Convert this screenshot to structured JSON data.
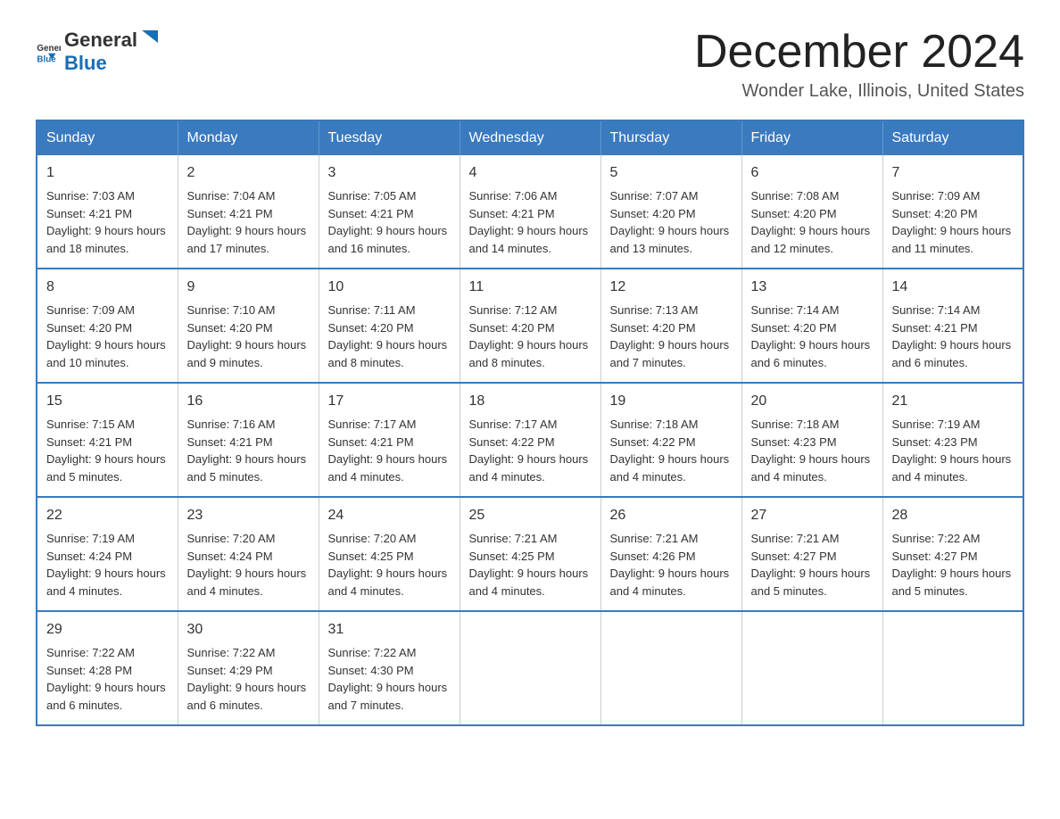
{
  "logo": {
    "text_general": "General",
    "text_blue": "Blue"
  },
  "title": "December 2024",
  "location": "Wonder Lake, Illinois, United States",
  "weekdays": [
    "Sunday",
    "Monday",
    "Tuesday",
    "Wednesday",
    "Thursday",
    "Friday",
    "Saturday"
  ],
  "weeks": [
    [
      {
        "day": "1",
        "sunrise": "7:03 AM",
        "sunset": "4:21 PM",
        "daylight": "9 hours and 18 minutes."
      },
      {
        "day": "2",
        "sunrise": "7:04 AM",
        "sunset": "4:21 PM",
        "daylight": "9 hours and 17 minutes."
      },
      {
        "day": "3",
        "sunrise": "7:05 AM",
        "sunset": "4:21 PM",
        "daylight": "9 hours and 16 minutes."
      },
      {
        "day": "4",
        "sunrise": "7:06 AM",
        "sunset": "4:21 PM",
        "daylight": "9 hours and 14 minutes."
      },
      {
        "day": "5",
        "sunrise": "7:07 AM",
        "sunset": "4:20 PM",
        "daylight": "9 hours and 13 minutes."
      },
      {
        "day": "6",
        "sunrise": "7:08 AM",
        "sunset": "4:20 PM",
        "daylight": "9 hours and 12 minutes."
      },
      {
        "day": "7",
        "sunrise": "7:09 AM",
        "sunset": "4:20 PM",
        "daylight": "9 hours and 11 minutes."
      }
    ],
    [
      {
        "day": "8",
        "sunrise": "7:09 AM",
        "sunset": "4:20 PM",
        "daylight": "9 hours and 10 minutes."
      },
      {
        "day": "9",
        "sunrise": "7:10 AM",
        "sunset": "4:20 PM",
        "daylight": "9 hours and 9 minutes."
      },
      {
        "day": "10",
        "sunrise": "7:11 AM",
        "sunset": "4:20 PM",
        "daylight": "9 hours and 8 minutes."
      },
      {
        "day": "11",
        "sunrise": "7:12 AM",
        "sunset": "4:20 PM",
        "daylight": "9 hours and 8 minutes."
      },
      {
        "day": "12",
        "sunrise": "7:13 AM",
        "sunset": "4:20 PM",
        "daylight": "9 hours and 7 minutes."
      },
      {
        "day": "13",
        "sunrise": "7:14 AM",
        "sunset": "4:20 PM",
        "daylight": "9 hours and 6 minutes."
      },
      {
        "day": "14",
        "sunrise": "7:14 AM",
        "sunset": "4:21 PM",
        "daylight": "9 hours and 6 minutes."
      }
    ],
    [
      {
        "day": "15",
        "sunrise": "7:15 AM",
        "sunset": "4:21 PM",
        "daylight": "9 hours and 5 minutes."
      },
      {
        "day": "16",
        "sunrise": "7:16 AM",
        "sunset": "4:21 PM",
        "daylight": "9 hours and 5 minutes."
      },
      {
        "day": "17",
        "sunrise": "7:17 AM",
        "sunset": "4:21 PM",
        "daylight": "9 hours and 4 minutes."
      },
      {
        "day": "18",
        "sunrise": "7:17 AM",
        "sunset": "4:22 PM",
        "daylight": "9 hours and 4 minutes."
      },
      {
        "day": "19",
        "sunrise": "7:18 AM",
        "sunset": "4:22 PM",
        "daylight": "9 hours and 4 minutes."
      },
      {
        "day": "20",
        "sunrise": "7:18 AM",
        "sunset": "4:23 PM",
        "daylight": "9 hours and 4 minutes."
      },
      {
        "day": "21",
        "sunrise": "7:19 AM",
        "sunset": "4:23 PM",
        "daylight": "9 hours and 4 minutes."
      }
    ],
    [
      {
        "day": "22",
        "sunrise": "7:19 AM",
        "sunset": "4:24 PM",
        "daylight": "9 hours and 4 minutes."
      },
      {
        "day": "23",
        "sunrise": "7:20 AM",
        "sunset": "4:24 PM",
        "daylight": "9 hours and 4 minutes."
      },
      {
        "day": "24",
        "sunrise": "7:20 AM",
        "sunset": "4:25 PM",
        "daylight": "9 hours and 4 minutes."
      },
      {
        "day": "25",
        "sunrise": "7:21 AM",
        "sunset": "4:25 PM",
        "daylight": "9 hours and 4 minutes."
      },
      {
        "day": "26",
        "sunrise": "7:21 AM",
        "sunset": "4:26 PM",
        "daylight": "9 hours and 4 minutes."
      },
      {
        "day": "27",
        "sunrise": "7:21 AM",
        "sunset": "4:27 PM",
        "daylight": "9 hours and 5 minutes."
      },
      {
        "day": "28",
        "sunrise": "7:22 AM",
        "sunset": "4:27 PM",
        "daylight": "9 hours and 5 minutes."
      }
    ],
    [
      {
        "day": "29",
        "sunrise": "7:22 AM",
        "sunset": "4:28 PM",
        "daylight": "9 hours and 6 minutes."
      },
      {
        "day": "30",
        "sunrise": "7:22 AM",
        "sunset": "4:29 PM",
        "daylight": "9 hours and 6 minutes."
      },
      {
        "day": "31",
        "sunrise": "7:22 AM",
        "sunset": "4:30 PM",
        "daylight": "9 hours and 7 minutes."
      },
      null,
      null,
      null,
      null
    ]
  ],
  "labels": {
    "sunrise": "Sunrise:",
    "sunset": "Sunset:",
    "daylight": "Daylight:"
  }
}
